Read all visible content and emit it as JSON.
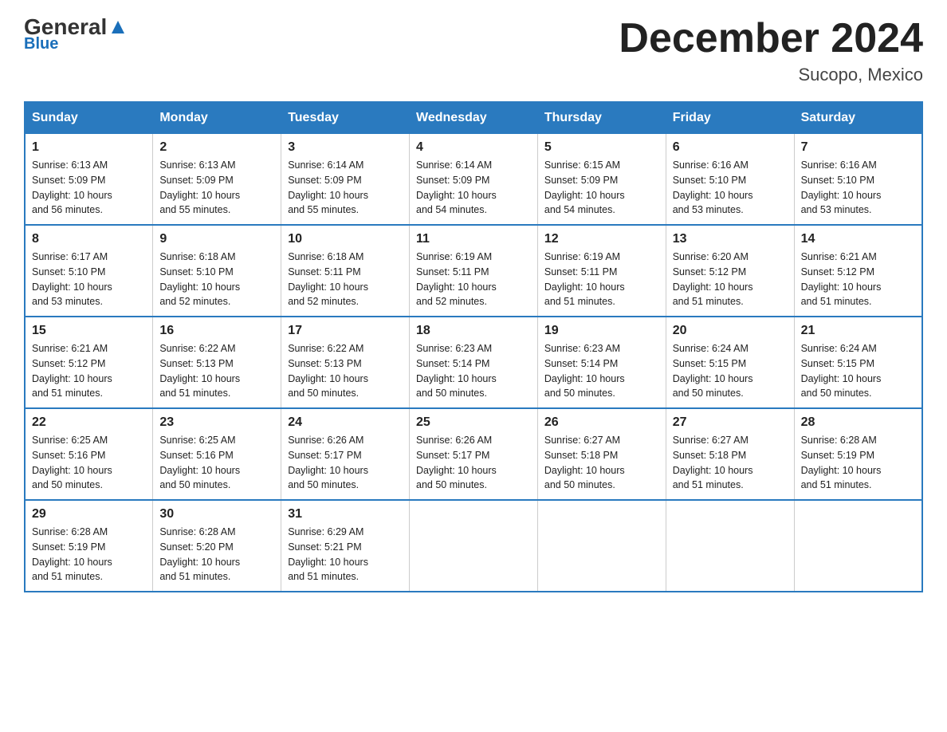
{
  "header": {
    "logo_general": "General",
    "logo_blue": "Blue",
    "month_title": "December 2024",
    "location": "Sucopo, Mexico"
  },
  "weekdays": [
    "Sunday",
    "Monday",
    "Tuesday",
    "Wednesday",
    "Thursday",
    "Friday",
    "Saturday"
  ],
  "weeks": [
    [
      {
        "day": "1",
        "sunrise": "6:13 AM",
        "sunset": "5:09 PM",
        "daylight": "10 hours and 56 minutes."
      },
      {
        "day": "2",
        "sunrise": "6:13 AM",
        "sunset": "5:09 PM",
        "daylight": "10 hours and 55 minutes."
      },
      {
        "day": "3",
        "sunrise": "6:14 AM",
        "sunset": "5:09 PM",
        "daylight": "10 hours and 55 minutes."
      },
      {
        "day": "4",
        "sunrise": "6:14 AM",
        "sunset": "5:09 PM",
        "daylight": "10 hours and 54 minutes."
      },
      {
        "day": "5",
        "sunrise": "6:15 AM",
        "sunset": "5:09 PM",
        "daylight": "10 hours and 54 minutes."
      },
      {
        "day": "6",
        "sunrise": "6:16 AM",
        "sunset": "5:10 PM",
        "daylight": "10 hours and 53 minutes."
      },
      {
        "day": "7",
        "sunrise": "6:16 AM",
        "sunset": "5:10 PM",
        "daylight": "10 hours and 53 minutes."
      }
    ],
    [
      {
        "day": "8",
        "sunrise": "6:17 AM",
        "sunset": "5:10 PM",
        "daylight": "10 hours and 53 minutes."
      },
      {
        "day": "9",
        "sunrise": "6:18 AM",
        "sunset": "5:10 PM",
        "daylight": "10 hours and 52 minutes."
      },
      {
        "day": "10",
        "sunrise": "6:18 AM",
        "sunset": "5:11 PM",
        "daylight": "10 hours and 52 minutes."
      },
      {
        "day": "11",
        "sunrise": "6:19 AM",
        "sunset": "5:11 PM",
        "daylight": "10 hours and 52 minutes."
      },
      {
        "day": "12",
        "sunrise": "6:19 AM",
        "sunset": "5:11 PM",
        "daylight": "10 hours and 51 minutes."
      },
      {
        "day": "13",
        "sunrise": "6:20 AM",
        "sunset": "5:12 PM",
        "daylight": "10 hours and 51 minutes."
      },
      {
        "day": "14",
        "sunrise": "6:21 AM",
        "sunset": "5:12 PM",
        "daylight": "10 hours and 51 minutes."
      }
    ],
    [
      {
        "day": "15",
        "sunrise": "6:21 AM",
        "sunset": "5:12 PM",
        "daylight": "10 hours and 51 minutes."
      },
      {
        "day": "16",
        "sunrise": "6:22 AM",
        "sunset": "5:13 PM",
        "daylight": "10 hours and 51 minutes."
      },
      {
        "day": "17",
        "sunrise": "6:22 AM",
        "sunset": "5:13 PM",
        "daylight": "10 hours and 50 minutes."
      },
      {
        "day": "18",
        "sunrise": "6:23 AM",
        "sunset": "5:14 PM",
        "daylight": "10 hours and 50 minutes."
      },
      {
        "day": "19",
        "sunrise": "6:23 AM",
        "sunset": "5:14 PM",
        "daylight": "10 hours and 50 minutes."
      },
      {
        "day": "20",
        "sunrise": "6:24 AM",
        "sunset": "5:15 PM",
        "daylight": "10 hours and 50 minutes."
      },
      {
        "day": "21",
        "sunrise": "6:24 AM",
        "sunset": "5:15 PM",
        "daylight": "10 hours and 50 minutes."
      }
    ],
    [
      {
        "day": "22",
        "sunrise": "6:25 AM",
        "sunset": "5:16 PM",
        "daylight": "10 hours and 50 minutes."
      },
      {
        "day": "23",
        "sunrise": "6:25 AM",
        "sunset": "5:16 PM",
        "daylight": "10 hours and 50 minutes."
      },
      {
        "day": "24",
        "sunrise": "6:26 AM",
        "sunset": "5:17 PM",
        "daylight": "10 hours and 50 minutes."
      },
      {
        "day": "25",
        "sunrise": "6:26 AM",
        "sunset": "5:17 PM",
        "daylight": "10 hours and 50 minutes."
      },
      {
        "day": "26",
        "sunrise": "6:27 AM",
        "sunset": "5:18 PM",
        "daylight": "10 hours and 50 minutes."
      },
      {
        "day": "27",
        "sunrise": "6:27 AM",
        "sunset": "5:18 PM",
        "daylight": "10 hours and 51 minutes."
      },
      {
        "day": "28",
        "sunrise": "6:28 AM",
        "sunset": "5:19 PM",
        "daylight": "10 hours and 51 minutes."
      }
    ],
    [
      {
        "day": "29",
        "sunrise": "6:28 AM",
        "sunset": "5:19 PM",
        "daylight": "10 hours and 51 minutes."
      },
      {
        "day": "30",
        "sunrise": "6:28 AM",
        "sunset": "5:20 PM",
        "daylight": "10 hours and 51 minutes."
      },
      {
        "day": "31",
        "sunrise": "6:29 AM",
        "sunset": "5:21 PM",
        "daylight": "10 hours and 51 minutes."
      },
      null,
      null,
      null,
      null
    ]
  ],
  "labels": {
    "sunrise": "Sunrise:",
    "sunset": "Sunset:",
    "daylight": "Daylight:"
  }
}
